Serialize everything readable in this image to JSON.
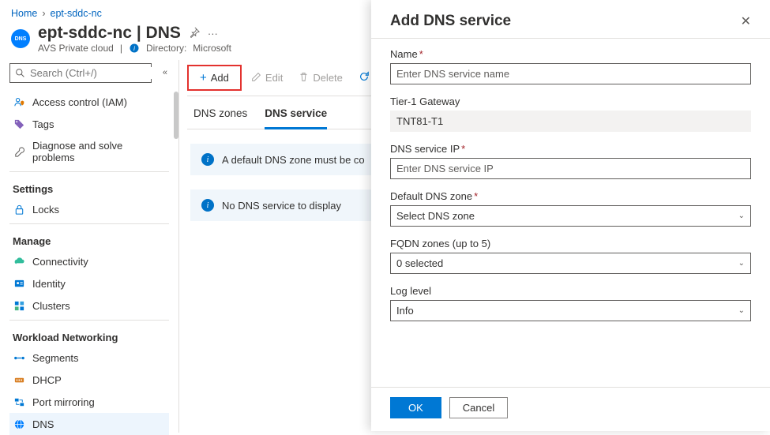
{
  "breadcrumb": {
    "home": "Home",
    "resource": "ept-sddc-nc"
  },
  "header": {
    "title": "ept-sddc-nc | DNS",
    "subtitle": "AVS Private cloud",
    "directory_prefix": "Directory:",
    "directory_value": "Microsoft"
  },
  "search": {
    "placeholder": "Search (Ctrl+/)"
  },
  "nav": {
    "access_control": "Access control (IAM)",
    "tags": "Tags",
    "diagnose": "Diagnose and solve problems",
    "section_settings": "Settings",
    "locks": "Locks",
    "section_manage": "Manage",
    "connectivity": "Connectivity",
    "identity": "Identity",
    "clusters": "Clusters",
    "section_workload": "Workload Networking",
    "segments": "Segments",
    "dhcp": "DHCP",
    "port_mirroring": "Port mirroring",
    "dns": "DNS"
  },
  "toolbar": {
    "add": "Add",
    "edit": "Edit",
    "delete": "Delete"
  },
  "tabs": {
    "zones": "DNS zones",
    "service": "DNS service"
  },
  "banners": {
    "default_zone": "A default DNS zone must be co",
    "no_service": "No DNS service to display"
  },
  "panel": {
    "title": "Add DNS service",
    "name_label": "Name",
    "name_placeholder": "Enter DNS service name",
    "tier1_label": "Tier-1 Gateway",
    "tier1_value": "TNT81-T1",
    "ip_label": "DNS service IP",
    "ip_placeholder": "Enter DNS service IP",
    "default_zone_label": "Default DNS zone",
    "default_zone_value": "Select DNS zone",
    "fqdn_label": "FQDN zones (up to 5)",
    "fqdn_value": "0 selected",
    "log_label": "Log level",
    "log_value": "Info",
    "ok": "OK",
    "cancel": "Cancel"
  }
}
